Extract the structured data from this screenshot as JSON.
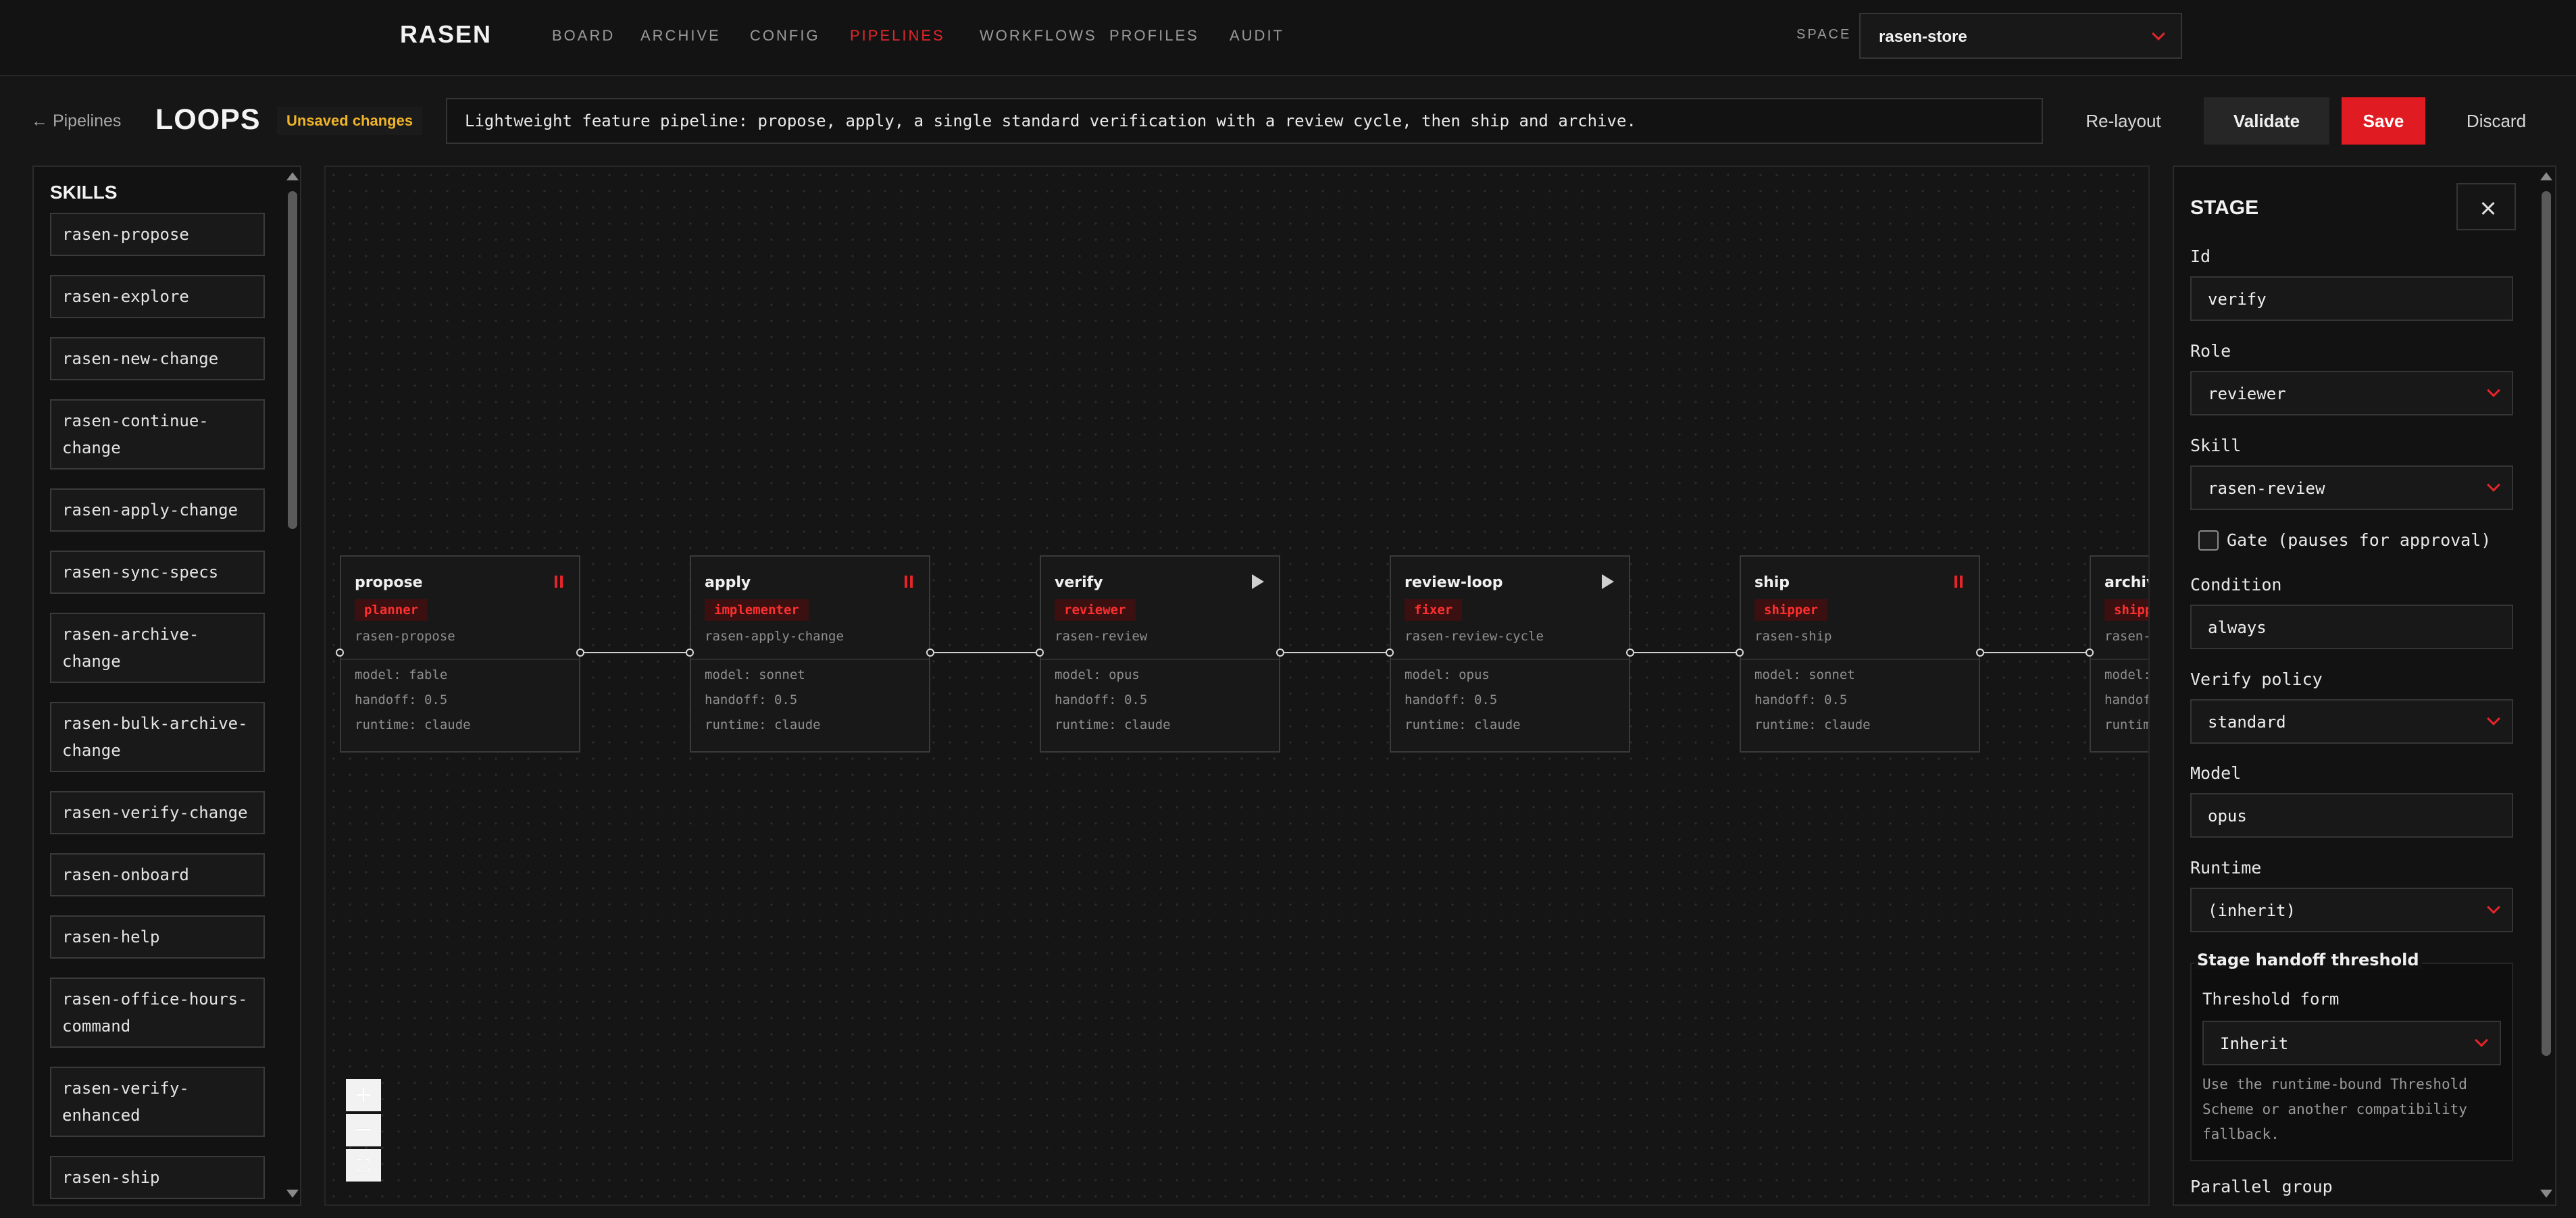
{
  "nav": {
    "brand": "RASEN",
    "items": [
      "BOARD",
      "ARCHIVE",
      "CONFIG",
      "PIPELINES",
      "WORKFLOWS",
      "PROFILES",
      "AUDIT"
    ],
    "active": "PIPELINES",
    "space_label": "SPACE",
    "space_value": "rasen-store"
  },
  "header": {
    "back_label": "← Pipelines",
    "title": "LOOPS",
    "unsaved_badge": "Unsaved changes",
    "description": "Lightweight feature pipeline: propose, apply, a single standard verification with a review cycle, then ship and archive.",
    "buttons": {
      "relayout": "Re-layout",
      "validate": "Validate",
      "save": "Save",
      "discard": "Discard"
    }
  },
  "skills": {
    "title": "SKILLS",
    "items": [
      "rasen-propose",
      "rasen-explore",
      "rasen-new-change",
      "rasen-continue-change",
      "rasen-apply-change",
      "rasen-sync-specs",
      "rasen-archive-change",
      "rasen-bulk-archive-change",
      "rasen-verify-change",
      "rasen-onboard",
      "rasen-help",
      "rasen-office-hours-command",
      "rasen-verify-enhanced",
      "rasen-ship"
    ]
  },
  "pipeline": {
    "stages": [
      {
        "id": "propose",
        "role": "planner",
        "skill": "rasen-propose",
        "model": "model: fable",
        "handoff": "handoff: 0.5",
        "runtime": "runtime: claude",
        "icon": "pause-icon"
      },
      {
        "id": "apply",
        "role": "implementer",
        "skill": "rasen-apply-change",
        "model": "model: sonnet",
        "handoff": "handoff: 0.5",
        "runtime": "runtime: claude",
        "icon": "pause-icon"
      },
      {
        "id": "verify",
        "role": "reviewer",
        "skill": "rasen-review",
        "model": "model: opus",
        "handoff": "handoff: 0.5",
        "runtime": "runtime: claude",
        "icon": "play-icon"
      },
      {
        "id": "review-loop",
        "role": "fixer",
        "skill": "rasen-review-cycle",
        "model": "model: opus",
        "handoff": "handoff: 0.5",
        "runtime": "runtime: claude",
        "icon": "play-icon"
      },
      {
        "id": "ship",
        "role": "shipper",
        "skill": "rasen-ship",
        "model": "model: sonnet",
        "handoff": "handoff: 0.5",
        "runtime": "runtime: claude",
        "icon": "pause-icon"
      },
      {
        "id": "archive",
        "role": "shipper",
        "skill": "rasen-",
        "model": "model:",
        "handoff": "handoff:",
        "runtime": "runtime:",
        "icon": ""
      }
    ],
    "zoom": {
      "in": "+",
      "out": "−",
      "fit": "⛶"
    }
  },
  "stage_panel": {
    "title": "STAGE",
    "fields": {
      "id": {
        "label": "Id",
        "value": "verify"
      },
      "role": {
        "label": "Role",
        "value": "reviewer"
      },
      "skill": {
        "label": "Skill",
        "value": "rasen-review"
      },
      "gate": {
        "label": "Gate (pauses for approval)",
        "checked": false
      },
      "condition": {
        "label": "Condition",
        "value": "always"
      },
      "verify_policy": {
        "label": "Verify policy",
        "value": "standard"
      },
      "model": {
        "label": "Model",
        "value": "opus"
      },
      "runtime": {
        "label": "Runtime",
        "value": "(inherit)"
      }
    },
    "threshold": {
      "legend": "Stage handoff threshold",
      "form_label": "Threshold form",
      "form_value": "Inherit",
      "help": "Use the runtime-bound Threshold Scheme or another compatibility fallback."
    },
    "parallel_label": "Parallel group"
  },
  "colors": {
    "accent": "#e5252a",
    "warning": "#f0b429",
    "background": "#161616"
  }
}
